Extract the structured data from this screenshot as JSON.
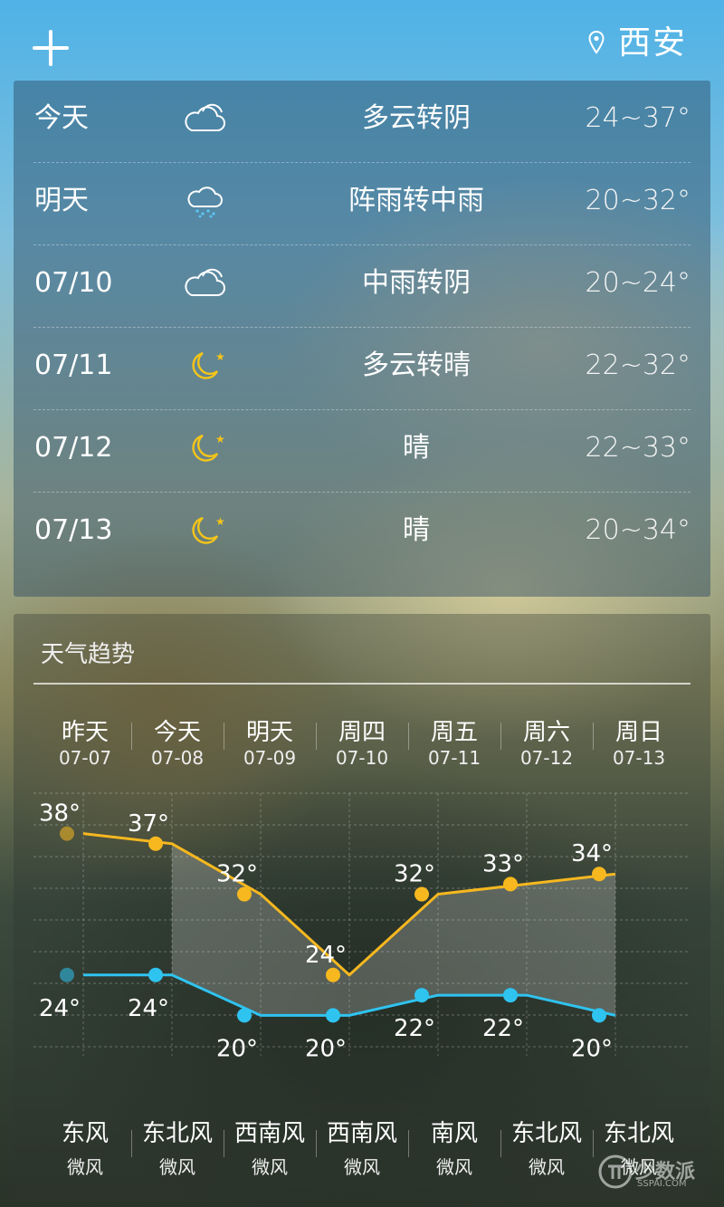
{
  "header": {
    "city": "西安",
    "add_icon": "plus-icon",
    "location_icon": "location-pin-icon"
  },
  "forecast": [
    {
      "day": "今天",
      "icon": "cloudy-icon",
      "desc": "多云转阴",
      "temp": "24~37°"
    },
    {
      "day": "明天",
      "icon": "rain-icon",
      "desc": "阵雨转中雨",
      "temp": "20~32°"
    },
    {
      "day": "07/10",
      "icon": "cloudy-icon",
      "desc": "中雨转阴",
      "temp": "20~24°"
    },
    {
      "day": "07/11",
      "icon": "moon-icon",
      "desc": "多云转晴",
      "temp": "22~32°"
    },
    {
      "day": "07/12",
      "icon": "moon-icon",
      "desc": "晴",
      "temp": "22~33°"
    },
    {
      "day": "07/13",
      "icon": "moon-icon",
      "desc": "晴",
      "temp": "20~34°"
    }
  ],
  "trend": {
    "title": "天气趋势",
    "days": [
      {
        "day": "昨天",
        "date": "07-07",
        "wind": "东风",
        "level": "微风"
      },
      {
        "day": "今天",
        "date": "07-08",
        "wind": "东北风",
        "level": "微风"
      },
      {
        "day": "明天",
        "date": "07-09",
        "wind": "西南风",
        "level": "微风"
      },
      {
        "day": "周四",
        "date": "07-10",
        "wind": "西南风",
        "level": "微风"
      },
      {
        "day": "周五",
        "date": "07-11",
        "wind": "南风",
        "level": "微风"
      },
      {
        "day": "周六",
        "date": "07-12",
        "wind": "东北风",
        "level": "微风"
      },
      {
        "day": "周日",
        "date": "07-13",
        "wind": "东北风",
        "level": "微风"
      }
    ]
  },
  "chart_data": {
    "type": "line",
    "categories": [
      "07-07",
      "07-08",
      "07-09",
      "07-10",
      "07-11",
      "07-12",
      "07-13"
    ],
    "series": [
      {
        "values": [
          38,
          37,
          32,
          24,
          32,
          33,
          34
        ],
        "color": "#f7b81f"
      },
      {
        "values": [
          24,
          24,
          20,
          20,
          22,
          22,
          20
        ],
        "color": "#2fc3f0"
      }
    ],
    "labels_high": [
      "38°",
      "37°",
      "32°",
      "24°",
      "32°",
      "33°",
      "34°"
    ],
    "labels_low": [
      "24°",
      "24°",
      "20°",
      "20°",
      "22°",
      "22°",
      "20°"
    ],
    "ylim": [
      16,
      42
    ],
    "grid": true
  },
  "watermark": {
    "text": "少数派",
    "sub": "SSPAI.COM"
  }
}
